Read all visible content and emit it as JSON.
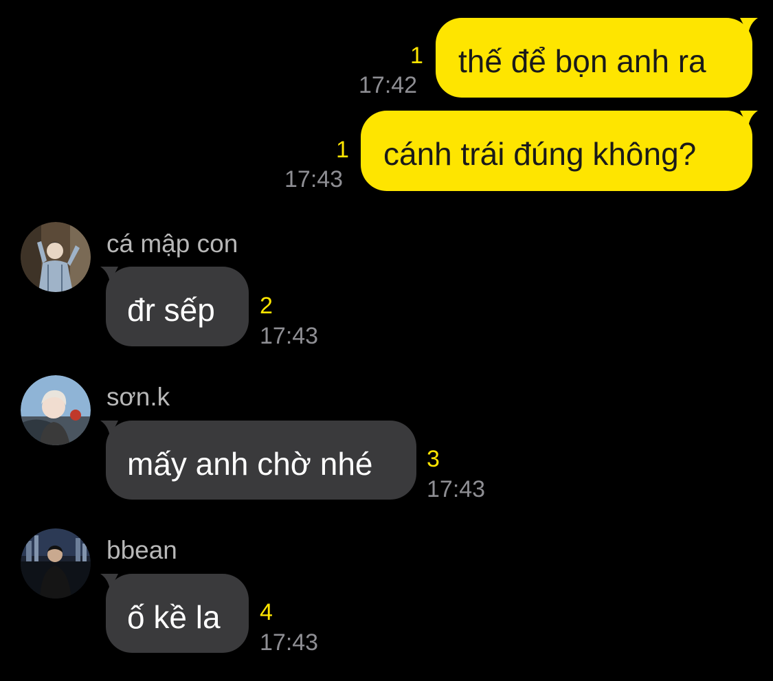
{
  "colors": {
    "background": "#000000",
    "outgoing_bubble": "#FEE500",
    "incoming_bubble": "#3A3A3C",
    "unread_count": "#FEE500",
    "timestamp": "#8E8E93"
  },
  "messages": [
    {
      "direction": "outgoing",
      "text": "thế để bọn anh ra",
      "unread": "1",
      "time": "17:42"
    },
    {
      "direction": "outgoing",
      "text": "cánh trái đúng không?",
      "unread": "1",
      "time": "17:43"
    },
    {
      "direction": "incoming",
      "sender": "cá mập con",
      "avatar_icon": "user-avatar-photo",
      "text": "đr sếp",
      "unread": "2",
      "time": "17:43"
    },
    {
      "direction": "incoming",
      "sender": "sơn.k",
      "avatar_icon": "user-avatar-photo",
      "text": "mấy anh chờ nhé",
      "unread": "3",
      "time": "17:43"
    },
    {
      "direction": "incoming",
      "sender": "bbean",
      "avatar_icon": "user-avatar-photo",
      "text": "ố kề la",
      "unread": "4",
      "time": "17:43"
    }
  ]
}
